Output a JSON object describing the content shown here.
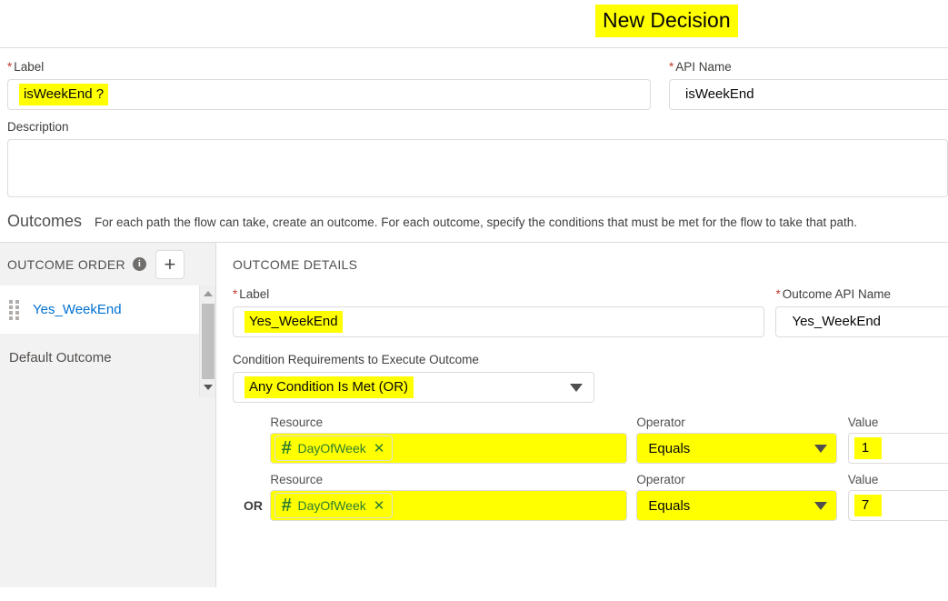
{
  "header": {
    "title": "New Decision"
  },
  "decision": {
    "label_field": {
      "label": "Label",
      "required": true,
      "value": "isWeekEnd ?"
    },
    "api_name_field": {
      "label": "API Name",
      "required": true,
      "value": "isWeekEnd"
    },
    "description_field": {
      "label": "Description",
      "value": ""
    }
  },
  "outcomes_section": {
    "title": "Outcomes",
    "description": "For each path the flow can take, create an outcome. For each outcome, specify the conditions that must be met for the flow to take that path."
  },
  "sidebar": {
    "header": "OUTCOME ORDER",
    "info_icon": "info-icon",
    "add_button": "+",
    "items": [
      {
        "label": "Yes_WeekEnd",
        "active": true
      },
      {
        "label": "Default Outcome",
        "active": false
      }
    ]
  },
  "detail": {
    "heading": "OUTCOME DETAILS",
    "label_field": {
      "label": "Label",
      "required": true,
      "value": "Yes_WeekEnd"
    },
    "api_name_field": {
      "label": "Outcome API Name",
      "required": true,
      "value": "Yes_WeekEnd"
    },
    "condition_requirements": {
      "label": "Condition Requirements to Execute Outcome",
      "value": "Any Condition Is Met (OR)"
    },
    "columns": {
      "resource": "Resource",
      "operator": "Operator",
      "value": "Value"
    },
    "conditions": [
      {
        "logic": "",
        "resource": "DayOfWeek",
        "resource_icon": "number-hash-icon",
        "operator": "Equals",
        "value": "1"
      },
      {
        "logic": "OR",
        "resource": "DayOfWeek",
        "resource_icon": "number-hash-icon",
        "operator": "Equals",
        "value": "7"
      }
    ]
  },
  "colors": {
    "highlight": "#ffff00",
    "link": "#0070d2",
    "required": "#c23934",
    "resource_green": "#2e7d32"
  }
}
